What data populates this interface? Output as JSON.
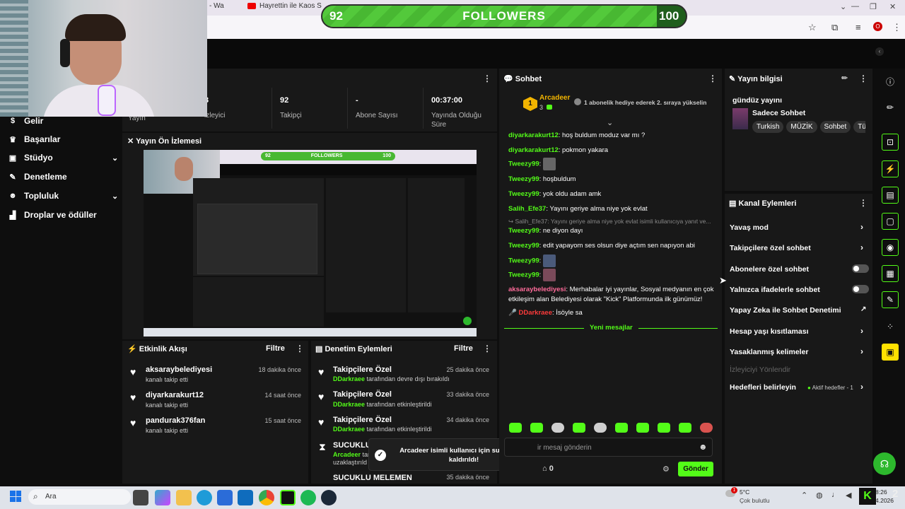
{
  "browser": {
    "tab1": "- Wa",
    "tab2": "Hayrettin ile Kaos Show - 2"
  },
  "followers_goal": {
    "current": "92",
    "label": "FOLLOWERS",
    "target": "100",
    "progress": 0.92
  },
  "nav": {
    "items": [
      "Gelir",
      "Başarılar",
      "Stüdyo",
      "Denetleme",
      "Topluluk",
      "Droplar ve ödüller"
    ]
  },
  "stats": {
    "partial1": "Yayın",
    "partial2": "izleyici",
    "partial_num": "3",
    "followers_value": "92",
    "followers_label": "Takipçi",
    "subs_value": "-",
    "subs_label": "Abone Sayısı",
    "time_value": "00:37:00",
    "time_label": "Yayında Olduğu Süre"
  },
  "preview": {
    "title": "Yayın Ön İzlemesi",
    "mini_current": "92",
    "mini_label": "FOLLOWERS",
    "mini_target": "100"
  },
  "activity": {
    "title": "Etkinlik Akışı",
    "filter": "Filtre",
    "items": [
      {
        "name": "aksaraybelediyesi",
        "action": "kanalı takip etti",
        "time": "18 dakika önce"
      },
      {
        "name": "diyarkarakurt12",
        "action": "kanalı takip etti",
        "time": "14 saat önce"
      },
      {
        "name": "pandurak376fan",
        "action": "kanalı takip etti",
        "time": "15 saat önce"
      }
    ]
  },
  "moderation": {
    "title": "Denetim Eylemleri",
    "filter": "Filtre",
    "items": [
      {
        "title": "Takipçilere Özel",
        "by": "DDarkraee",
        "desc": " tarafından devre dışı bırakıldı",
        "time": "25 dakika önce"
      },
      {
        "title": "Takipçilere Özel",
        "by": "DDarkraee",
        "desc": " tarafından etkinleştirildi",
        "time": "33 dakika önce"
      },
      {
        "title": "Takipçilere Özel",
        "by": "DDarkraee",
        "desc": " tarafından etkinleştirildi",
        "time": "34 dakika önce"
      },
      {
        "title": "SUCUKLU_",
        "by": "Arcadeer",
        "desc": " tara",
        "desc2": "uzaklaştırıld",
        "time": ""
      },
      {
        "title": "SUCUKLU MELEMEN",
        "by": "",
        "desc": "",
        "time": "35 dakika önce"
      }
    ]
  },
  "toast": {
    "text": "Arcadeer isimli kullanıcı için susturulma kaldırıldı!"
  },
  "chat": {
    "title": "Sohbet",
    "pinned_user": "Arcadeer",
    "pinned_rank": "1",
    "pinned_count": "3",
    "pinned_msg": "1 abonelik hediye ederek 2. sıraya yükselin",
    "messages": [
      {
        "user": "diyarkarakurt12",
        "text": ": hoş buldum moduz var mı ?"
      },
      {
        "user": "diyarkarakurt12",
        "text": ": pokmon yakara"
      },
      {
        "user": "Tweezy99",
        "text": ":"
      },
      {
        "user": "Tweezy99",
        "text": ": hoşbuldum"
      },
      {
        "user": "Tweezy99",
        "text": ": yok oldu adam amk"
      },
      {
        "user": "Salih_Efe37",
        "text": ": Yayını geriye alma niye yok evlat"
      },
      {
        "user": "",
        "text": "↪ Salih_Efe37: Yayını geriye alma niye yok evlat isimli kullanıcıya yanıt ve..."
      },
      {
        "user": "Tweezy99",
        "text": ": ne diyon dayı"
      },
      {
        "user": "Tweezy99",
        "text": ": edit yapayom ses olsun diye açtım sen napıyon abi"
      },
      {
        "user": "Tweezy99",
        "text": ":"
      },
      {
        "user": "Tweezy99",
        "text": ":"
      },
      {
        "user": "aksaraybelediyesi",
        "text": ": Merhabalar iyi yayınlar, Sosyal medyanın en çok"
      },
      {
        "user": "",
        "text": "etkileşim alan Belediyesi olarak \"Kick\" Platformunda ilk günümüz!"
      },
      {
        "user": "DDarkraee",
        "text": ": İsöyle sa"
      }
    ],
    "new_messages": "Yeni mesajlar",
    "input_placeholder": "ir mesaj gönderin",
    "points": "0",
    "send": "Gönder"
  },
  "stream_info": {
    "title": "Yayın bilgisi",
    "stream_title": "gündüz yayını",
    "category": "Sadece Sohbet",
    "tags": [
      "Turkish",
      "MÜZİK",
      "Sohbet",
      "Tür"
    ]
  },
  "channel_actions": {
    "title": "Kanal Eylemleri",
    "slow_mode": "Yavaş mod",
    "followers_only": "Takipçilere özel sohbet",
    "subs_only": "Abonelere özel sohbet",
    "emotes_only": "Yalnızca ifadelerle sohbet",
    "ai_mod": "Yapay Zeka ile Sohbet Denetimi",
    "age_limit": "Hesap yaşı kısıtlaması",
    "banned_words": "Yasaklanmış kelimeler",
    "redirect": "İzleyiciyi Yönlendir",
    "goals": "Hedefleri belirleyin",
    "goals_active": "Aktif hedefler - 1"
  },
  "taskbar": {
    "search": "Ara",
    "weather_temp": "5°C",
    "weather_desc": "Çok bulutlu",
    "weather_badge": "1",
    "time": "8:26",
    "date": "4.2026",
    "notif": "2"
  },
  "colors": {
    "accent": "#53fc18",
    "panel": "#181818"
  }
}
